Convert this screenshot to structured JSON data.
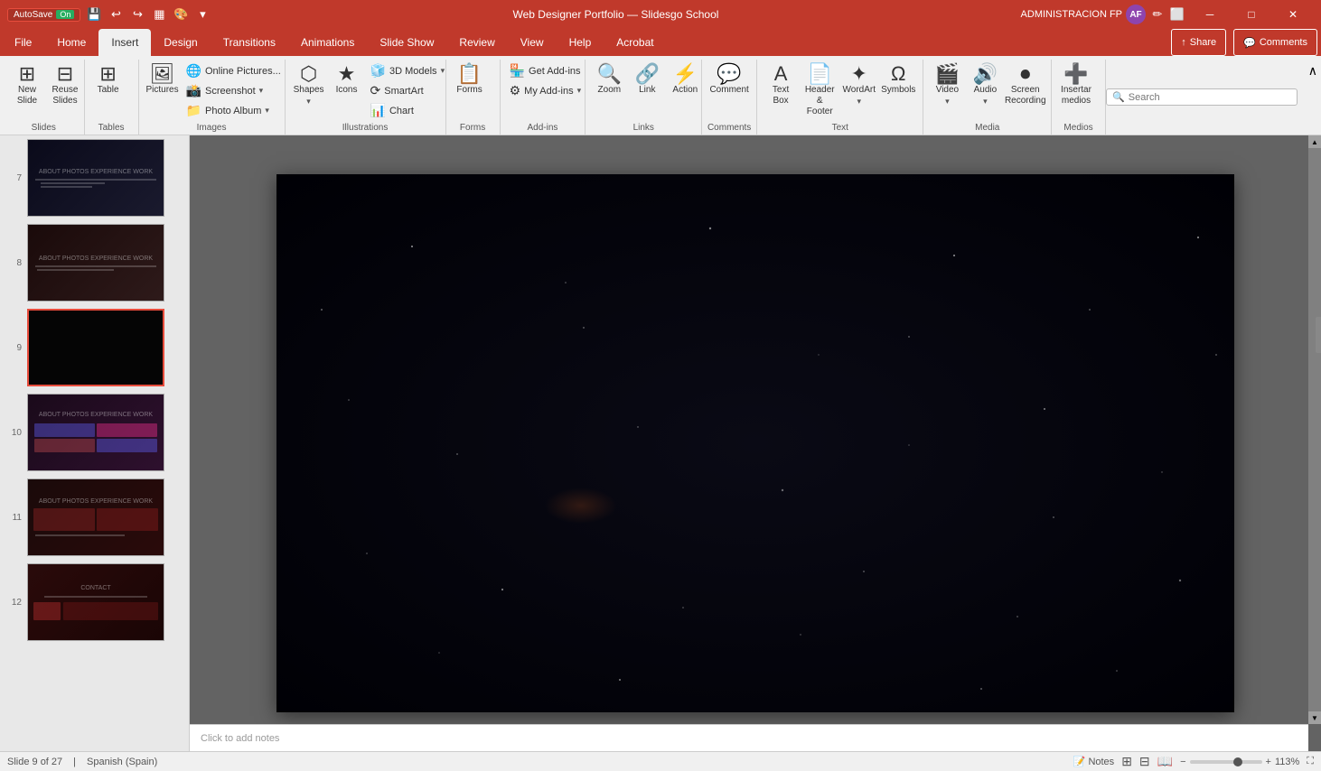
{
  "titleBar": {
    "autosave": "AutoSave",
    "autosave_state": "On",
    "title": "Web Designer Portfolio — Slidesg​o School",
    "admin": "ADMINISTRACION FP",
    "user_initials": "AF",
    "minimize": "🗕",
    "maximize": "🗗",
    "close": "✕"
  },
  "ribbonTabs": {
    "tabs": [
      "File",
      "Home",
      "Insert",
      "Design",
      "Transitions",
      "Animations",
      "Slide Show",
      "Review",
      "View",
      "Help",
      "Acrobat"
    ],
    "active": "Insert",
    "share": "Share",
    "comments": "Comments"
  },
  "ribbon": {
    "groups": {
      "slides": {
        "label": "Slides",
        "buttons": [
          "New Slide",
          "Reuse Slides"
        ]
      },
      "tables": {
        "label": "Tables",
        "buttons": [
          "Table"
        ]
      },
      "images": {
        "label": "Images",
        "buttons": [
          "Pictures",
          "Online Pictures...",
          "Screenshot",
          "Photo Album"
        ]
      },
      "illustrations": {
        "label": "Illustrations",
        "buttons": [
          "Shapes",
          "Icons",
          "3D Models",
          "SmartArt",
          "Chart"
        ]
      },
      "forms": {
        "label": "Forms",
        "buttons": [
          "Forms"
        ]
      },
      "addins": {
        "label": "Add-ins",
        "buttons": [
          "Get Add-ins",
          "My Add-ins"
        ]
      },
      "links": {
        "label": "Links",
        "buttons": [
          "Zoom",
          "Link",
          "Action"
        ]
      },
      "comments": {
        "label": "Comments",
        "buttons": [
          "Comment"
        ]
      },
      "text": {
        "label": "Text",
        "buttons": [
          "Text Box",
          "Header & Footer",
          "WordArt",
          "Symbols"
        ]
      },
      "media": {
        "label": "Media",
        "buttons": [
          "Video",
          "Audio",
          "Screen Recording"
        ]
      },
      "medios": {
        "label": "Medios",
        "buttons": [
          "Insertar medios"
        ]
      }
    },
    "search_placeholder": "Search"
  },
  "slidePanel": {
    "slides": [
      {
        "number": "7",
        "type": "dark-web"
      },
      {
        "number": "8",
        "type": "dark-web"
      },
      {
        "number": "9",
        "type": "black",
        "selected": true
      },
      {
        "number": "10",
        "type": "dark-colorful"
      },
      {
        "number": "11",
        "type": "dark-red"
      },
      {
        "number": "12",
        "type": "dark-red2"
      }
    ]
  },
  "canvas": {
    "notes_placeholder": "Click to add notes"
  },
  "statusBar": {
    "slide_info": "Slide 9 of 27",
    "language": "Spanish (Spain)",
    "notes": "Notes",
    "zoom": "113%"
  }
}
